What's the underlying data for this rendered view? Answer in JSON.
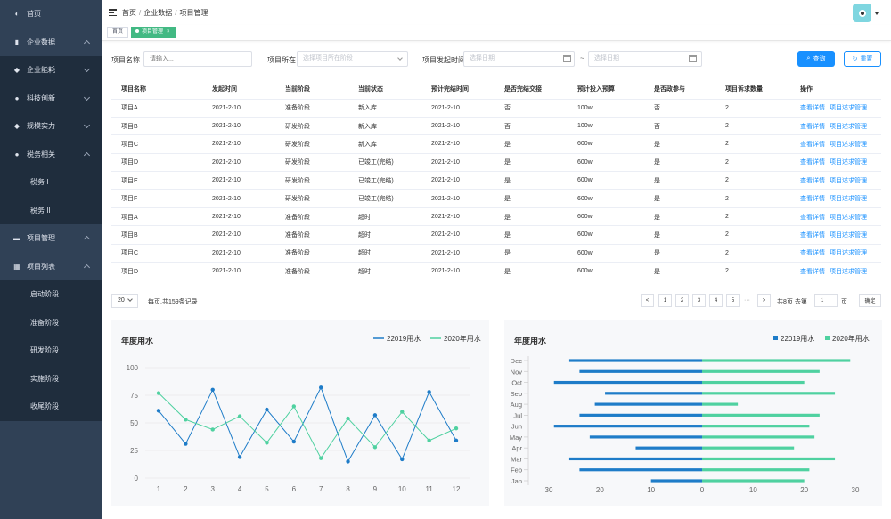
{
  "sidebar": {
    "items": [
      {
        "label": "首页",
        "icon": "dashboard-icon"
      },
      {
        "label": "企业数据",
        "icon": "bar-chart-icon"
      },
      {
        "label": "企业能耗",
        "icon": "drop-icon"
      },
      {
        "label": "科技创新",
        "icon": "bulb-icon"
      },
      {
        "label": "规模实力",
        "icon": "shield-icon"
      },
      {
        "label": "税务相关",
        "icon": "coins-icon"
      },
      {
        "label": "税务 I"
      },
      {
        "label": "税务 II"
      },
      {
        "label": "项目管理",
        "icon": "folder-icon"
      },
      {
        "label": "项目列表",
        "icon": "grid-icon"
      },
      {
        "label": "启动阶段"
      },
      {
        "label": "准备阶段"
      },
      {
        "label": "研发阶段"
      },
      {
        "label": "实施阶段"
      },
      {
        "label": "收尾阶段"
      }
    ]
  },
  "breadcrumb": [
    "首页",
    "企业数据",
    "项目管理"
  ],
  "breadcrumb_sep": "/",
  "tags": [
    {
      "label": "首页"
    },
    {
      "label": "项目管理",
      "close": "×"
    }
  ],
  "filters": {
    "name_label": "项目名称",
    "name_placeholder": "请输入...",
    "stage_label": "项目所在",
    "stage_placeholder": "选择项目所在阶段",
    "date_label": "项目发起时间",
    "start_placeholder": "选择日期",
    "date_sep": "~",
    "end_placeholder": "选择日期",
    "search_btn": "查询",
    "reset_btn": "重置"
  },
  "table": {
    "columns": [
      "项目名称",
      "发起时间",
      "当前阶段",
      "当前状态",
      "预计完结时间",
      "是否完结交接",
      "预计投入预算",
      "是否政参与",
      "项目诉求数量",
      "操作"
    ],
    "action_view": "查看详情",
    "action_req": "项目述求管理",
    "rows": [
      [
        "项目A",
        "2021-2-10",
        "准备阶段",
        "新入库",
        "2021-2-10",
        "否",
        "100w",
        "否",
        "2"
      ],
      [
        "项目B",
        "2021-2-10",
        "研发阶段",
        "新入库",
        "2021-2-10",
        "否",
        "100w",
        "否",
        "2"
      ],
      [
        "项目C",
        "2021-2-10",
        "研发阶段",
        "新入库",
        "2021-2-10",
        "是",
        "600w",
        "是",
        "2"
      ],
      [
        "项目D",
        "2021-2-10",
        "研发阶段",
        "已竣工(完结)",
        "2021-2-10",
        "是",
        "600w",
        "是",
        "2"
      ],
      [
        "项目E",
        "2021-2-10",
        "研发阶段",
        "已竣工(完结)",
        "2021-2-10",
        "是",
        "600w",
        "是",
        "2"
      ],
      [
        "项目F",
        "2021-2-10",
        "研发阶段",
        "已竣工(完结)",
        "2021-2-10",
        "是",
        "600w",
        "是",
        "2"
      ],
      [
        "项目A",
        "2021-2-10",
        "准备阶段",
        "超时",
        "2021-2-10",
        "是",
        "600w",
        "是",
        "2"
      ],
      [
        "项目B",
        "2021-2-10",
        "准备阶段",
        "超时",
        "2021-2-10",
        "是",
        "600w",
        "是",
        "2"
      ],
      [
        "项目C",
        "2021-2-10",
        "准备阶段",
        "超时",
        "2021-2-10",
        "是",
        "600w",
        "是",
        "2"
      ],
      [
        "项目D",
        "2021-2-10",
        "准备阶段",
        "超时",
        "2021-2-10",
        "是",
        "600w",
        "是",
        "2"
      ]
    ]
  },
  "pagination": {
    "page_size": "20",
    "summary": "每页,共159条记录",
    "prev": "<",
    "pages": [
      "1",
      "2",
      "3",
      "4",
      "5"
    ],
    "ellipsis": "···",
    "next": ">",
    "total_pages": "共8页 去第",
    "goto_value": "1",
    "page_unit": "页",
    "confirm": "确定"
  },
  "colors": {
    "blue": "#1e7cc8",
    "green": "#4fd1a0",
    "sidebar": "#304156",
    "primary": "#1890ff"
  },
  "chart_data": [
    {
      "type": "line",
      "title": "年度用水",
      "x": [
        1,
        2,
        3,
        4,
        5,
        6,
        7,
        8,
        9,
        10,
        11,
        12
      ],
      "ylim": [
        0,
        100
      ],
      "yticks": [
        0,
        25,
        50,
        75,
        100
      ],
      "legend_position": "top-right",
      "series": [
        {
          "name": "22019用水",
          "values": [
            61,
            31,
            80,
            19,
            62,
            33,
            82,
            15,
            57,
            17,
            78,
            34
          ]
        },
        {
          "name": "2020年用水",
          "values": [
            77,
            53,
            44,
            56,
            32,
            65,
            18,
            54,
            28,
            60,
            34,
            45
          ]
        }
      ]
    },
    {
      "type": "bar",
      "orientation": "horizontal-butterfly",
      "title": "年度用水",
      "categories": [
        "Jan",
        "Feb",
        "Mar",
        "Apr",
        "May",
        "Jun",
        "Jul",
        "Aug",
        "Sep",
        "Oct",
        "Nov",
        "Dec"
      ],
      "xticks": [
        "30",
        "20",
        "10",
        "0",
        "10",
        "20",
        "30"
      ],
      "xlim": [
        -30,
        30
      ],
      "legend_position": "top-right",
      "series": [
        {
          "name": "22019用水",
          "values": [
            10,
            24,
            26,
            13,
            22,
            29,
            24,
            21,
            19,
            29,
            24,
            26
          ]
        },
        {
          "name": "2020年用水",
          "values": [
            20,
            21,
            26,
            18,
            22,
            21,
            23,
            7,
            26,
            20,
            23,
            29
          ]
        }
      ]
    }
  ]
}
